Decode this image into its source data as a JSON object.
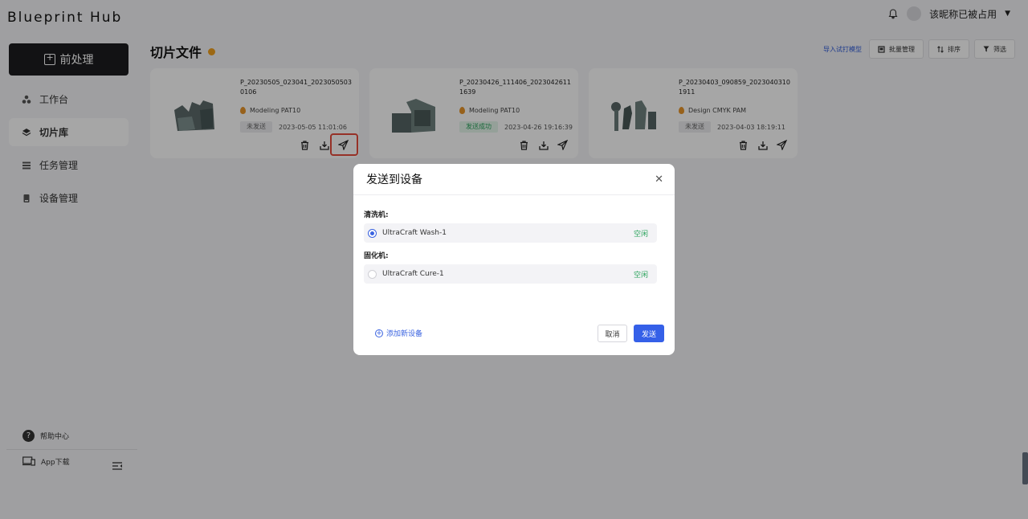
{
  "app": {
    "title": "Blueprint Hub"
  },
  "user": {
    "name": "该昵称已被占用"
  },
  "sidebar": {
    "preprocess_label": "前处理",
    "items": [
      {
        "label": "工作台",
        "icon": "workbench-icon"
      },
      {
        "label": "切片库",
        "icon": "layers-icon",
        "active": true
      },
      {
        "label": "任务管理",
        "icon": "task-icon"
      },
      {
        "label": "设备管理",
        "icon": "device-icon"
      }
    ],
    "help_label": "帮助中心",
    "app_download_label": "App下载"
  },
  "main": {
    "title": "切片文件",
    "import_label": "导入试打模型",
    "batch_label": "批量管理",
    "sort_label": "排序",
    "filter_label": "筛选"
  },
  "cards": [
    {
      "filename": "P_20230505_023041_20230505030106",
      "material": "Modeling PAT10",
      "status": "未发送",
      "time": "2023-05-05 11:01:06"
    },
    {
      "filename": "P_20230426_111406_20230426111639",
      "material": "Modeling PAT10",
      "status": "发送成功",
      "time": "2023-04-26 19:16:39"
    },
    {
      "filename": "P_20230403_090859_20230403101911",
      "material": "Design CMYK PAM",
      "status": "未发送",
      "time": "2023-04-03 18:19:11"
    }
  ],
  "modal": {
    "title": "发送到设备",
    "washer_label": "清洗机:",
    "washer_device": "UltraCraft Wash-1",
    "washer_status": "空闲",
    "curer_label": "固化机:",
    "curer_device": "UltraCraft Cure-1",
    "curer_status": "空闲",
    "add_device_label": "添加新设备",
    "cancel_label": "取消",
    "send_label": "发送"
  },
  "colors": {
    "primary": "#3560e8",
    "success": "#2aa35c",
    "highlight": "#e74c3c",
    "accent": "#f0a020"
  }
}
